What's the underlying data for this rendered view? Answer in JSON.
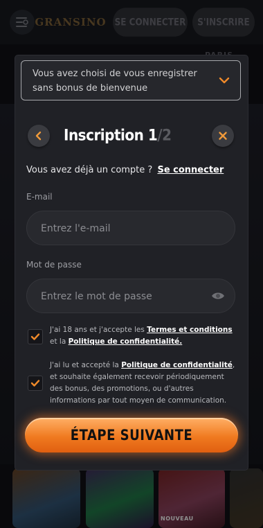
{
  "topbar": {
    "logo_text": "GRANSINO",
    "login_label": "SE CONNECTER",
    "signup_label": "S'INSCRIRE"
  },
  "background": {
    "partial_label": "PARIS",
    "new_badge": "NOUVEAU"
  },
  "bonus_select": {
    "text": "Vous avez choisi de vous enregistrer sans bonus de bienvenue",
    "icon": "chevron-down-icon"
  },
  "header": {
    "title": "Inscription ",
    "step_current": "1",
    "step_total": "/2",
    "back_icon": "chevron-left-icon",
    "close_icon": "close-icon"
  },
  "account": {
    "prompt": "Vous avez déjà un compte ?",
    "link": "Se connecter"
  },
  "email": {
    "label": "E-mail",
    "placeholder": "Entrez l'e-mail",
    "value": ""
  },
  "password": {
    "label": "Mot de passe",
    "placeholder": "Entrez le mot de passe",
    "value": ""
  },
  "consent_terms": {
    "checked": true,
    "text_before": "J'ai 18 ans et j'accepte les ",
    "terms_link": "Termes et conditions",
    "text_middle": " et la ",
    "privacy_link": "Politique de confidentialité."
  },
  "consent_marketing": {
    "checked": true,
    "text_before": "J'ai lu et accepté la ",
    "privacy_link": "Politique de confidentialité",
    "text_after": ", et souhaite également recevoir périodiquement des bonus, des promotions, ou d'autres informations par tout moyen de communication."
  },
  "cta": {
    "label": "ÉTAPE SUIVANTE"
  },
  "colors": {
    "accent": "#f07a20",
    "modal_bg": "#202126",
    "field_bg": "#28292e"
  }
}
